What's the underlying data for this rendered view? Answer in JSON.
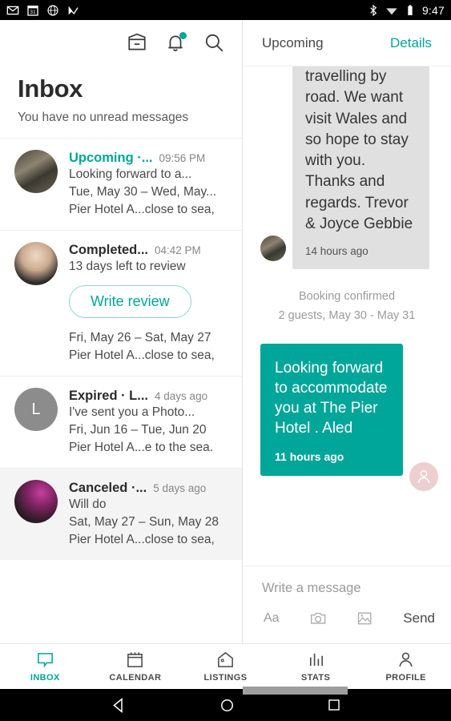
{
  "statusbar": {
    "time": "9:47",
    "left_icons": [
      "gmail-icon",
      "calendar-icon",
      "globe-icon",
      "tick-icon"
    ],
    "right_icons": [
      "bluetooth-icon",
      "wifi-icon",
      "battery-icon"
    ]
  },
  "inbox": {
    "toolbar": {
      "archive_icon": "archive-icon",
      "bell_icon": "bell-icon",
      "search_icon": "search-icon",
      "badge_color": "#00a699"
    },
    "title": "Inbox",
    "subtitle": "You have no unread messages",
    "threads": [
      {
        "status": "Upcoming ·...",
        "status_color": "teal",
        "time": "09:56 PM",
        "preview": "Looking forward to a...",
        "dates": "Tue, May 30 – Wed, May...",
        "listing": "Pier Hotel A...close to sea,",
        "avatar_type": "photo",
        "avatar_initial": "",
        "selected": false,
        "button": null
      },
      {
        "status": "Completed...",
        "status_color": "dark",
        "time": "04:42 PM",
        "preview": "13 days left to review",
        "dates": "Fri, May 26 – Sat, May 27",
        "listing": "Pier Hotel A...close to sea,",
        "avatar_type": "photo",
        "avatar_initial": "",
        "selected": false,
        "button": "Write review"
      },
      {
        "status": "Expired · L...",
        "status_color": "dark",
        "time": "4 days ago",
        "preview": "I've sent you a Photo...",
        "dates": "Fri, Jun 16 – Tue, Jun 20",
        "listing": "Pier Hotel A...e to the sea.",
        "avatar_type": "initial",
        "avatar_initial": "L",
        "selected": false,
        "button": null
      },
      {
        "status": "Canceled ·...",
        "status_color": "dark",
        "time": "5 days ago",
        "preview": "Will do",
        "dates": "Sat, May 27 – Sun, May 28",
        "listing": "Pier Hotel A...close to sea,",
        "avatar_type": "photo",
        "avatar_initial": "",
        "selected": true,
        "button": null
      }
    ]
  },
  "conversation": {
    "header": {
      "title": "Upcoming",
      "action": "Details"
    },
    "incoming": {
      "text": "for a short travelling by road. We want visit  Wales and so hope to stay with you. Thanks and regards. Trevor & Joyce Gebbie",
      "timestamp": "14 hours ago"
    },
    "system": {
      "line1": "Booking confirmed",
      "line2": "2 guests, May 30 - May 31"
    },
    "outgoing": {
      "text": "Looking forward to accommodate you at The Pier Hotel . Aled",
      "timestamp": "11 hours ago",
      "bubble_color": "#00a699"
    },
    "composer": {
      "placeholder": "Write a message",
      "text_tool": "Aa",
      "camera_icon": "camera-icon",
      "gallery_icon": "image-icon",
      "send_label": "Send"
    }
  },
  "tabbar": {
    "active_color": "#00a699",
    "tabs": [
      {
        "label": "INBOX",
        "icon": "chat-bubble-icon",
        "active": true
      },
      {
        "label": "CALENDAR",
        "icon": "calendar-icon",
        "active": false
      },
      {
        "label": "LISTINGS",
        "icon": "house-icon",
        "active": false
      },
      {
        "label": "STATS",
        "icon": "bar-chart-icon",
        "active": false
      },
      {
        "label": "PROFILE",
        "icon": "person-icon",
        "active": false
      }
    ]
  },
  "navbar": {
    "back": "back-triangle-icon",
    "home": "home-circle-icon",
    "recents": "recents-square-icon"
  }
}
